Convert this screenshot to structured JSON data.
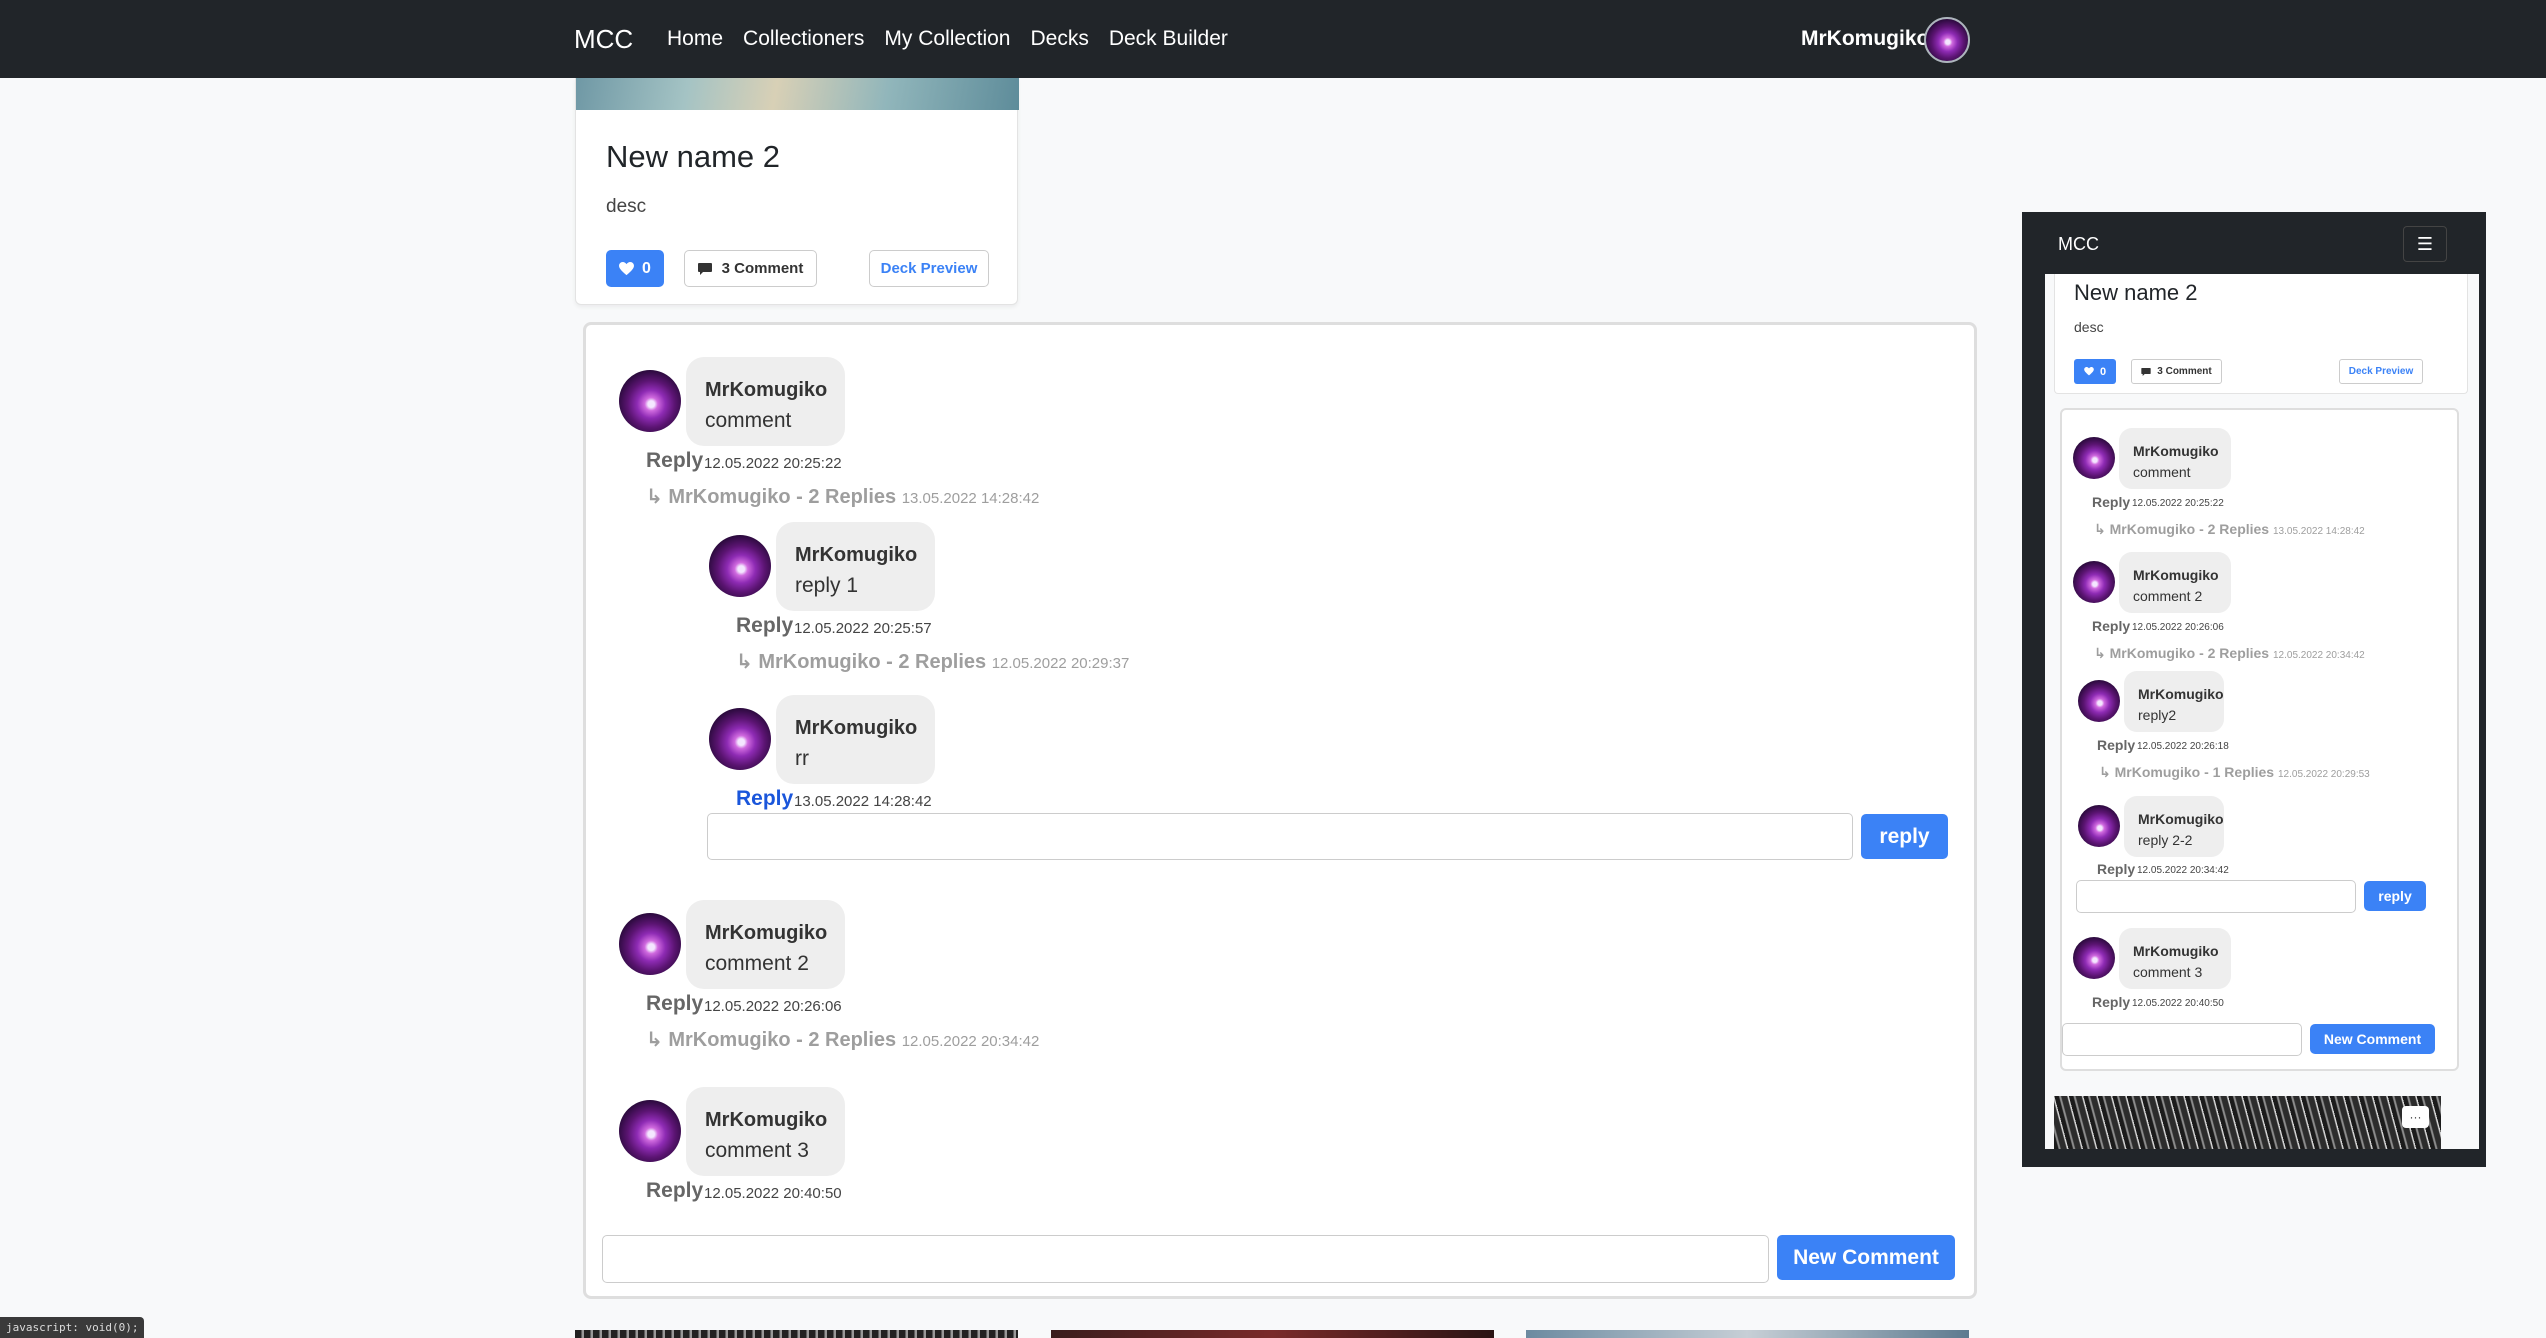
{
  "navbar": {
    "brand": "MCC",
    "links": [
      "Home",
      "Collectioners",
      "My Collection",
      "Decks",
      "Deck Builder"
    ],
    "user": "MrKomugiko"
  },
  "deck": {
    "title": "New name 2",
    "description": "desc",
    "likes": "0",
    "comment_label": "3 Comment",
    "preview_label": "Deck Preview"
  },
  "comments": {
    "c1": {
      "author": "MrKomugiko",
      "text": "comment",
      "reply": "Reply",
      "time": "12.05.2022 20:25:22",
      "thread": "MrKomugiko - 2 Replies",
      "thread_time": "13.05.2022 14:28:42"
    },
    "r1": {
      "author": "MrKomugiko",
      "text": "reply 1",
      "reply": "Reply",
      "time": "12.05.2022 20:25:57",
      "thread": "MrKomugiko - 2 Replies",
      "thread_time": "12.05.2022 20:29:37"
    },
    "r2": {
      "author": "MrKomugiko",
      "text": "rr",
      "reply": "Reply",
      "time": "13.05.2022 14:28:42"
    },
    "reply_button": "reply",
    "c2": {
      "author": "MrKomugiko",
      "text": "comment 2",
      "reply": "Reply",
      "time": "12.05.2022 20:26:06",
      "thread": "MrKomugiko - 2 Replies",
      "thread_time": "12.05.2022 20:34:42"
    },
    "c3": {
      "author": "MrKomugiko",
      "text": "comment 3",
      "reply": "Reply",
      "time": "12.05.2022 20:40:50"
    },
    "new_comment_button": "New Comment"
  },
  "mobile": {
    "brand": "MCC",
    "deck_title": "New name 2",
    "deck_desc": "desc",
    "likes": "0",
    "comment_label": "3 Comment",
    "preview_label": "Deck Preview",
    "c1": {
      "author": "MrKomugiko",
      "text": "comment",
      "reply": "Reply",
      "time": "12.05.2022 20:25:22",
      "thread": "MrKomugiko - 2 Replies",
      "thread_time": "13.05.2022 14:28:42"
    },
    "c2": {
      "author": "MrKomugiko",
      "text": "comment 2",
      "reply": "Reply",
      "time": "12.05.2022 20:26:06",
      "thread": "MrKomugiko - 2 Replies",
      "thread_time": "12.05.2022 20:34:42"
    },
    "r1": {
      "author": "MrKomugiko",
      "text": "reply2",
      "reply": "Reply",
      "time": "12.05.2022 20:26:18",
      "thread": "MrKomugiko - 1 Replies",
      "thread_time": "12.05.2022 20:29:53"
    },
    "r2": {
      "author": "MrKomugiko",
      "text": "reply 2-2",
      "reply": "Reply",
      "time": "12.05.2022 20:34:42"
    },
    "reply_button": "reply",
    "c3": {
      "author": "MrKomugiko",
      "text": "comment 3",
      "reply": "Reply",
      "time": "12.05.2022 20:40:50"
    },
    "new_comment_button": "New Comment",
    "more_label": "···"
  },
  "status_bar": "javascript: void(0);"
}
